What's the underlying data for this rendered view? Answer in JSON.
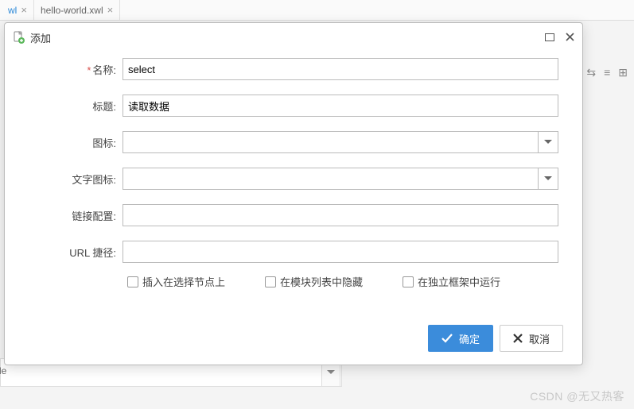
{
  "tabs": [
    {
      "label": "wl"
    },
    {
      "label": "hello-world.xwl"
    }
  ],
  "modal": {
    "title": "添加",
    "fields": {
      "name_label": "名称:",
      "name_value": "select",
      "title_label": "标题:",
      "title_value": "读取数据",
      "icon_label": "图标:",
      "icon_value": "",
      "texticon_label": "文字图标:",
      "texticon_value": "",
      "link_label": "链接配置:",
      "link_value": "",
      "url_label": "URL 捷径:",
      "url_value": ""
    },
    "checkboxes": {
      "insert_label": "插入在选择节点上",
      "hide_label": "在模块列表中隐藏",
      "frame_label": "在独立框架中运行"
    },
    "buttons": {
      "ok": "确定",
      "cancel": "取消"
    }
  },
  "watermark": "CSDN @无又热客",
  "bottom_partial": "le"
}
